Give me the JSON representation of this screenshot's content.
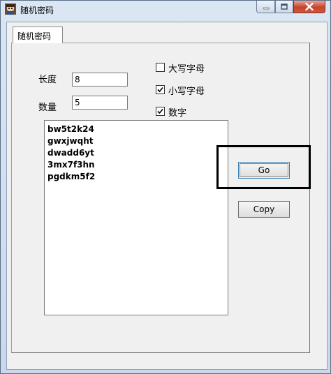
{
  "window": {
    "title": "随机密码",
    "icon": "app-avatar-icon"
  },
  "controls": {
    "minimize_icon": "minimize-icon",
    "maximize_icon": "maximize-icon",
    "close_icon": "close-icon"
  },
  "tab": {
    "label": "随机密码"
  },
  "form": {
    "length_label": "长度",
    "length_value": "8",
    "count_label": "数量",
    "count_value": "5"
  },
  "options": [
    {
      "label": "大写字母",
      "checked": false
    },
    {
      "label": "小写字母",
      "checked": true
    },
    {
      "label": "数字",
      "checked": true
    }
  ],
  "results": [
    "bw5t2k24",
    "gwxjwqht",
    "dwadd6yt",
    "3mx7f3hn",
    "pgdkm5f2"
  ],
  "buttons": {
    "go_label": "Go",
    "copy_label": "Copy"
  },
  "colors": {
    "close_button": "#c7432b",
    "highlight": "#000000",
    "focus": "#3c7fb1"
  }
}
